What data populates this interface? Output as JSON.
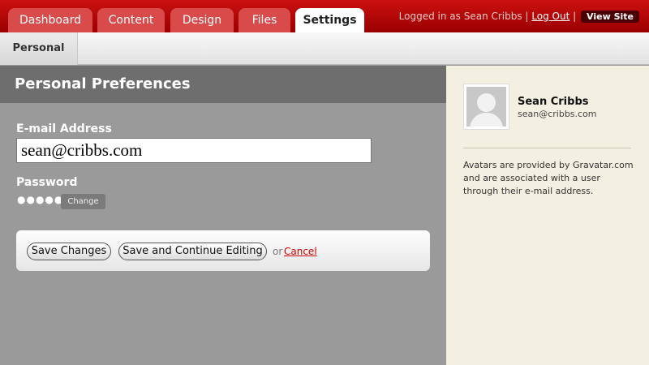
{
  "header": {
    "tabs": [
      {
        "label": "Dashboard",
        "active": false
      },
      {
        "label": "Content",
        "active": false
      },
      {
        "label": "Design",
        "active": false
      },
      {
        "label": "Files",
        "active": false
      },
      {
        "label": "Settings",
        "active": true
      }
    ],
    "logged_in_text": "Logged in as Sean Cribbs |",
    "logout_label": "Log Out",
    "separator": "|",
    "view_site_label": "View Site"
  },
  "subnav": {
    "tabs": [
      {
        "label": "Personal",
        "active": true
      }
    ]
  },
  "main": {
    "title": "Personal Preferences",
    "email_label": "E-mail Address",
    "email_value": "sean@cribbs.com",
    "password_label": "Password",
    "password_masked": "●●●●●",
    "change_label": "Change",
    "save_label": "Save Changes",
    "save_continue_label": "Save and Continue Editing",
    "or_text": "or",
    "cancel_label": "Cancel"
  },
  "sidebar": {
    "name": "Sean Cribbs",
    "email": "sean@cribbs.com",
    "note": "Avatars are provided by Gravatar.com and are associated with a user through their e-mail address."
  },
  "colors": {
    "header_red": "#cc1010",
    "tab_inactive": "#d94a4a",
    "panel_gray": "#9a9a9a",
    "panel_header": "#6e6e6e",
    "sidebar_bg": "#f3f0e2",
    "cancel_link": "#cc0000"
  },
  "icons": {
    "avatar": "default-user-avatar-icon"
  }
}
